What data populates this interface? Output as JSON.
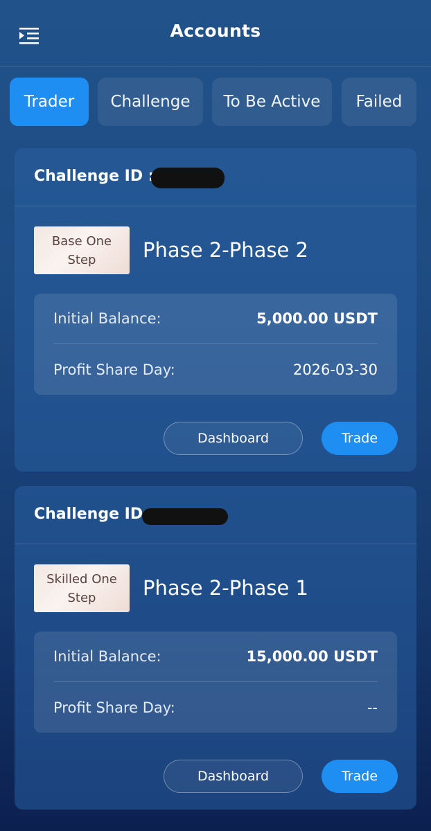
{
  "header": {
    "title": "Accounts",
    "menu_icon": "menu-collapse-icon"
  },
  "tabs": [
    {
      "label": "Trader",
      "active": true
    },
    {
      "label": "Challenge",
      "active": false
    },
    {
      "label": "To Be Active",
      "active": false
    },
    {
      "label": "Failed",
      "active": false
    }
  ],
  "accounts": [
    {
      "challenge_id_label": "Challenge ID :",
      "badge": "Base One Step",
      "phase": "Phase 2-Phase 2",
      "initial_balance_label": "Initial Balance:",
      "initial_balance_value": "5,000.00 USDT",
      "profit_share_label": "Profit Share Day:",
      "profit_share_value": "2026-03-30",
      "dashboard_label": "Dashboard",
      "trade_label": "Trade"
    },
    {
      "challenge_id_label": "Challenge ID :",
      "badge": "Skilled One Step",
      "phase": "Phase 2-Phase 1",
      "initial_balance_label": "Initial Balance:",
      "initial_balance_value": "15,000.00 USDT",
      "profit_share_label": "Profit Share Day:",
      "profit_share_value": "--",
      "dashboard_label": "Dashboard",
      "trade_label": "Trade"
    }
  ],
  "colors": {
    "accent": "#1e8ef3",
    "badge_bg": "#f3e7e2"
  }
}
